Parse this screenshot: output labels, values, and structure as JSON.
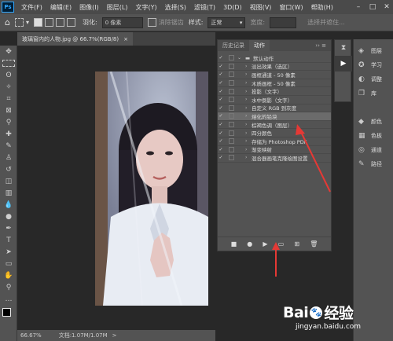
{
  "menubar": {
    "logo": "Ps",
    "items": [
      "文件(F)",
      "编辑(E)",
      "图像(I)",
      "图层(L)",
      "文字(Y)",
      "选择(S)",
      "滤镜(T)",
      "3D(D)",
      "视图(V)",
      "窗口(W)",
      "帮助(H)"
    ],
    "win_min": "–",
    "win_max": "□",
    "win_close": "✕"
  },
  "options": {
    "feather_label": "羽化:",
    "feather_value": "0 像素",
    "antialias": "消除锯齿",
    "style_label": "样式:",
    "style_value": "正常",
    "width_label": "宽度:",
    "select_mask": "选择并遮住..."
  },
  "document_tab": {
    "title": "玻璃窗内的人物.jpg @ 66.7%(RGB/8)",
    "close": "×"
  },
  "status": {
    "zoom": "66.67%",
    "doc_info": "文档:1.07M/1.07M",
    "arrow": ">"
  },
  "actions_panel": {
    "tab_history": "历史记录",
    "tab_actions": "动作",
    "header_icons": "›› ≡",
    "rows": [
      {
        "label": "默认动作",
        "folder": true,
        "open": true
      },
      {
        "label": "淡出效果（选区）"
      },
      {
        "label": "画框通道 - 50 像素"
      },
      {
        "label": "木质画框 - 50 像素"
      },
      {
        "label": "投影（文字）"
      },
      {
        "label": "水中倒影（文字）"
      },
      {
        "label": "自定义 RGB 到灰度"
      },
      {
        "label": "熔化的铅块",
        "highlight": true
      },
      {
        "label": "棕褐色调（图层）"
      },
      {
        "label": "四分颜色"
      },
      {
        "label": "存储为 Photoshop PDF"
      },
      {
        "label": "渐变映射"
      },
      {
        "label": "混合器画笔克隆绘图设置"
      }
    ],
    "bottom_buttons": [
      "■",
      "●",
      "▶",
      "▭",
      "⊞",
      "🗑"
    ]
  },
  "dock": {
    "items": [
      {
        "icon": "layers-icon",
        "glyph": "◈",
        "label": "图层"
      },
      {
        "icon": "learn-icon",
        "glyph": "✪",
        "label": "学习"
      },
      {
        "icon": "adjust-icon",
        "glyph": "◐",
        "label": "调整"
      },
      {
        "icon": "library-icon",
        "glyph": "❐",
        "label": "库"
      },
      {
        "icon": "color-icon",
        "glyph": "◆",
        "label": "颜色"
      },
      {
        "icon": "swatches-icon",
        "glyph": "▦",
        "label": "色板"
      },
      {
        "icon": "channels-icon",
        "glyph": "◎",
        "label": "通道"
      },
      {
        "icon": "paths-icon",
        "glyph": "✎",
        "label": "路径"
      }
    ]
  },
  "watermark": {
    "brand": "Bai",
    "brand2": "经验",
    "url": "jingyan.baidu.com"
  },
  "colors": {
    "accent": "#31a8ff",
    "annotation_red": "#e53935"
  }
}
